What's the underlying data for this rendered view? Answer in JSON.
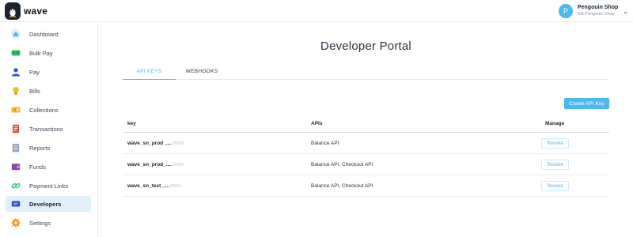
{
  "app": {
    "brand": "wave"
  },
  "account": {
    "avatar_initial": "P",
    "name": "Pengouin Shop",
    "subtitle": "SN Pengouin Shop"
  },
  "sidebar": {
    "items": [
      {
        "label": "Dashboard",
        "icon": "home-icon",
        "color": "#4cb8f0",
        "active": false
      },
      {
        "label": "Bulk Pay",
        "icon": "bulk-pay-icon",
        "color": "#2ecc71",
        "active": false
      },
      {
        "label": "Pay",
        "icon": "person-icon",
        "color": "#2d4fd6",
        "active": false
      },
      {
        "label": "Bills",
        "icon": "lightbulb-icon",
        "color": "#f5b82e",
        "active": false
      },
      {
        "label": "Collections",
        "icon": "collections-icon",
        "color": "#f5b82e",
        "active": false
      },
      {
        "label": "Transactions",
        "icon": "receipt-icon",
        "color": "#e74c3c",
        "active": false
      },
      {
        "label": "Reports",
        "icon": "report-icon",
        "color": "#7f8c9d",
        "active": false
      },
      {
        "label": "Funds",
        "icon": "wallet-icon",
        "color": "#8e44ad",
        "active": false
      },
      {
        "label": "Payment Links",
        "icon": "link-icon",
        "color": "#2ecc71",
        "active": false
      },
      {
        "label": "Developers",
        "icon": "code-icon",
        "color": "#2d4fd6",
        "active": true
      },
      {
        "label": "Settings",
        "icon": "gear-icon",
        "color": "#f39c12",
        "active": false
      }
    ]
  },
  "main": {
    "title": "Developer Portal",
    "tabs": [
      {
        "label": "API KEYS",
        "active": true
      },
      {
        "label": "WEBHOOKS",
        "active": false
      }
    ],
    "create_button": "Create API Key",
    "table": {
      "headers": {
        "key": "key",
        "apis": "APIs",
        "manage": "Manage"
      },
      "rows": [
        {
          "key": "wave_sn_prod_....",
          "apis": "Balance API",
          "action": "Revoke"
        },
        {
          "key": "wave_sn_prod_....",
          "apis": "Balance API, Checkout API",
          "action": "Revoke"
        },
        {
          "key": "wave_sn_test_....",
          "apis": "Balance API, Checkout API",
          "action": "Revoke"
        }
      ]
    }
  },
  "colors": {
    "accent": "#4cb8f0",
    "active_bg": "#dff0fb"
  }
}
